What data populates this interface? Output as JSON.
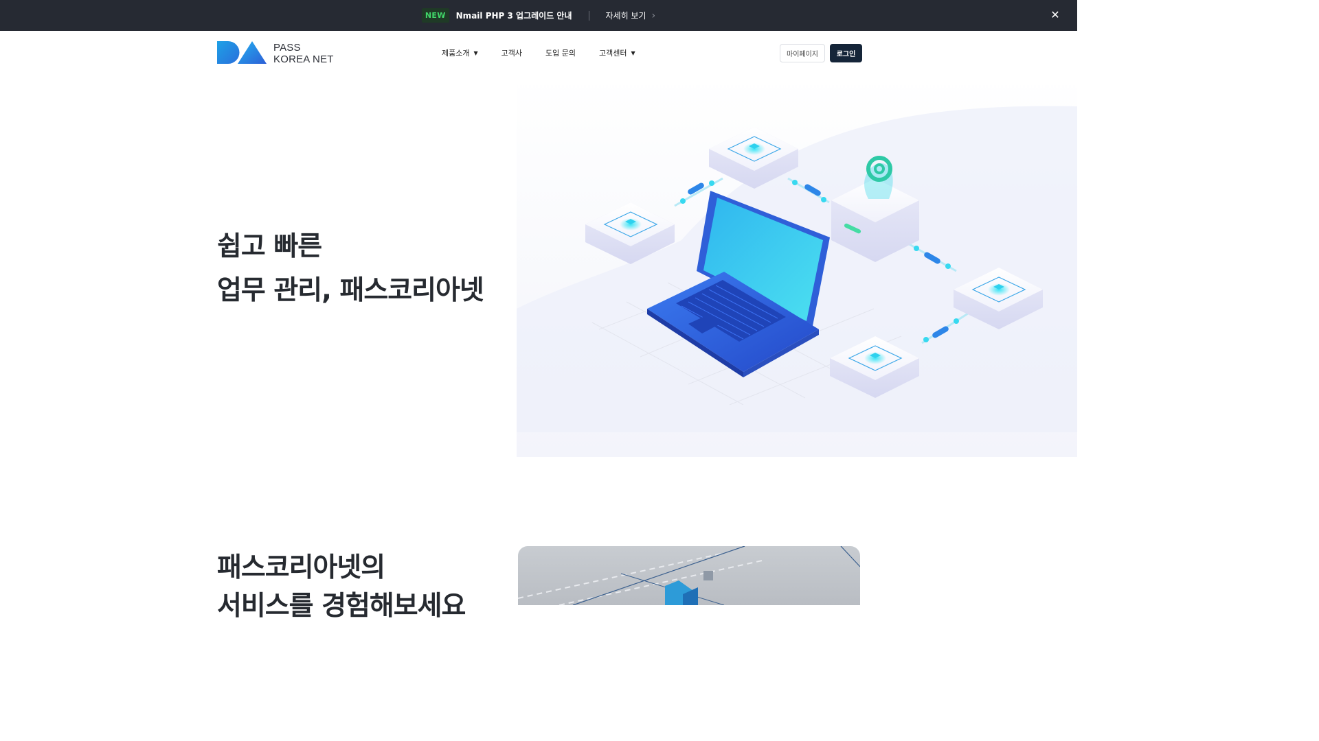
{
  "announcement": {
    "badge": "NEW",
    "text": "Nmail PHP 3 업그레이드 안내",
    "link_label": "자세히 보기",
    "close_icon": "close-icon"
  },
  "header": {
    "logo_line1": "PASS",
    "logo_line2": "KOREA NET",
    "nav": [
      {
        "label": "제품소개",
        "has_dropdown": true
      },
      {
        "label": "고객사",
        "has_dropdown": false
      },
      {
        "label": "도입 문의",
        "has_dropdown": false
      },
      {
        "label": "고객센터",
        "has_dropdown": true
      }
    ],
    "mypage_label": "마이페이지",
    "login_label": "로그인"
  },
  "hero": {
    "title_line1": "쉽고 빠른",
    "title_line2": "업무 관리, 패스코리아넷"
  },
  "section2": {
    "title_line1": "패스코리아넷의",
    "title_line2": "서비스를 경험해보세요"
  },
  "colors": {
    "topbar_bg": "#262a33",
    "badge_text": "#41d76a",
    "login_bg": "#152539",
    "brand_blue": "#2b7fe0",
    "laptop_blue": "#2f5fd8"
  }
}
